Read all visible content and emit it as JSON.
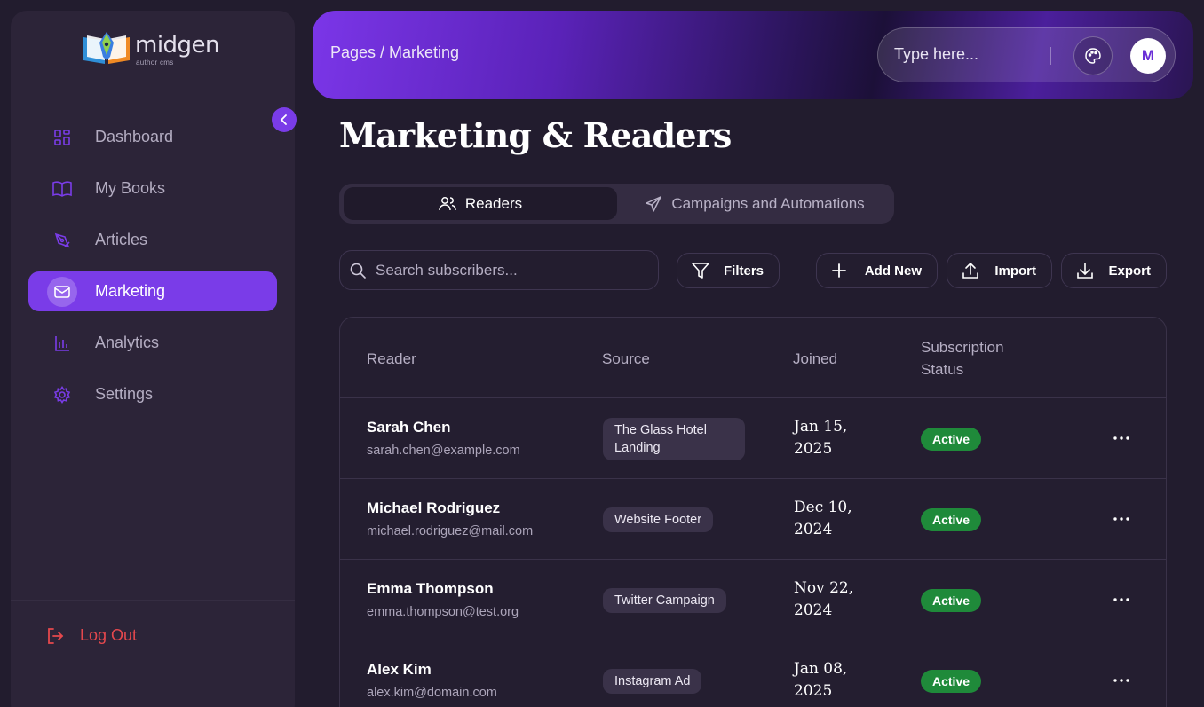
{
  "brand": {
    "name": "midgen",
    "tagline": "author cms"
  },
  "sidebar": {
    "items": [
      {
        "label": "Dashboard",
        "icon": "grid-icon"
      },
      {
        "label": "My Books",
        "icon": "book-open-icon"
      },
      {
        "label": "Articles",
        "icon": "pen-nib-icon"
      },
      {
        "label": "Marketing",
        "icon": "mail-icon",
        "active": true
      },
      {
        "label": "Analytics",
        "icon": "bar-chart-icon"
      },
      {
        "label": "Settings",
        "icon": "gear-icon"
      }
    ],
    "logout_label": "Log Out"
  },
  "header": {
    "breadcrumb": "Pages / Marketing",
    "search_placeholder": "Type here...",
    "avatar_initial": "M"
  },
  "main": {
    "title": "Marketing & Readers",
    "tabs": [
      {
        "label": "Readers",
        "active": true
      },
      {
        "label": "Campaigns and Automations"
      }
    ],
    "search_placeholder": "Search subscribers...",
    "buttons": {
      "filters": "Filters",
      "add_new": "Add New",
      "import": "Import",
      "export": "Export"
    },
    "table": {
      "columns": [
        "Reader",
        "Source",
        "Joined",
        "Subscription Status"
      ],
      "rows": [
        {
          "name": "Sarah Chen",
          "email": "sarah.chen@example.com",
          "source": "The Glass Hotel Landing",
          "joined": "Jan 15, 2025",
          "status": "Active"
        },
        {
          "name": "Michael Rodriguez",
          "email": "michael.rodriguez@mail.com",
          "source": "Website Footer",
          "joined": "Dec 10, 2024",
          "status": "Active"
        },
        {
          "name": "Emma Thompson",
          "email": "emma.thompson@test.org",
          "source": "Twitter Campaign",
          "joined": "Nov 22, 2024",
          "status": "Active"
        },
        {
          "name": "Alex Kim",
          "email": "alex.kim@domain.com",
          "source": "Instagram Ad",
          "joined": "Jan 08, 2025",
          "status": "Active"
        }
      ]
    }
  },
  "colors": {
    "accent": "#7a3ce8",
    "active_badge": "#1f8a3a",
    "logout": "#e5484d"
  }
}
